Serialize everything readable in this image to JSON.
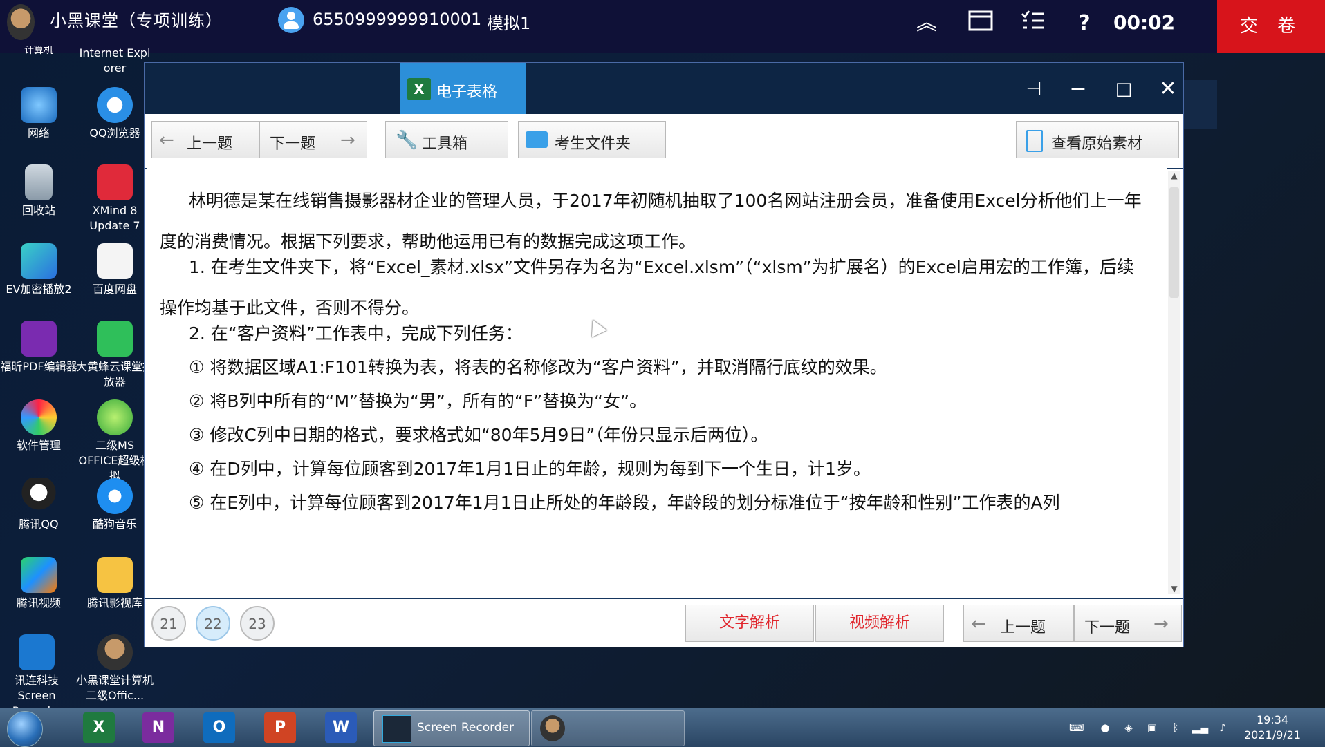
{
  "topbar": {
    "title": "小黑课堂（专项训练）",
    "user_id": "6550999999910001",
    "mode": "模拟1",
    "timer": "00:02",
    "submit_label": "交 卷"
  },
  "desktop": {
    "partial_labels": [
      "计算机",
      "Internet Expl orer"
    ],
    "icons": [
      {
        "label": "网络"
      },
      {
        "label": "QQ浏览器"
      },
      {
        "label": "回收站"
      },
      {
        "label": "XMind 8 Update 7"
      },
      {
        "label": "EV加密播放2"
      },
      {
        "label": "百度网盘"
      },
      {
        "label": "福昕PDF编辑器"
      },
      {
        "label": "大黄蜂云课堂播放器"
      },
      {
        "label": "软件管理"
      },
      {
        "label": "二级MS OFFICE超级模拟"
      },
      {
        "label": "腾讯QQ"
      },
      {
        "label": "酷狗音乐"
      },
      {
        "label": "腾讯视频"
      },
      {
        "label": "腾讯影视库"
      },
      {
        "label": "讯连科技 Screen Record..."
      },
      {
        "label": "小黑课堂计算机二级Offic..."
      }
    ]
  },
  "window": {
    "tab_label": "电子表格",
    "tab_badge": "X",
    "toolbar": {
      "prev": "上一题",
      "next": "下一题",
      "toolbox": "工具箱",
      "folder": "考生文件夹",
      "view_original": "查看原始素材"
    },
    "paragraphs": [
      "林明德是某在线销售摄影器材企业的管理人员，于2017年初随机抽取了100名网站注册会员，准备使用Excel分析他们上一年度的消费情况。根据下列要求，帮助他运用已有的数据完成这项工作。",
      "1. 在考生文件夹下，将“Excel_素材.xlsx”文件另存为名为“Excel.xlsm”（“xlsm”为扩展名）的Excel启用宏的工作簿，后续操作均基于此文件，否则不得分。",
      "2. 在“客户资料”工作表中，完成下列任务：",
      "① 将数据区域A1:F101转换为表，将表的名称修改为“客户资料”，并取消隔行底纹的效果。",
      "② 将B列中所有的“M”替换为“男”，所有的“F”替换为“女”。",
      "③ 修改C列中日期的格式，要求格式如“80年5月9日”（年份只显示后两位）。",
      "④ 在D列中，计算每位顾客到2017年1月1日止的年龄，规则为每到下一个生日，计1岁。",
      "⑤ 在E列中，计算每位顾客到2017年1月1日止所处的年龄段，年龄段的划分标准位于“按年龄和性别”工作表的A列"
    ],
    "bottom": {
      "questions": [
        "21",
        "22",
        "23"
      ],
      "active_question": "22",
      "text_analysis": "文字解析",
      "video_analysis": "视频解析",
      "prev": "上一题",
      "next": "下一题"
    }
  },
  "taskbar": {
    "active_app": "Screen Recorder",
    "time": "19:34",
    "date": "2021/9/21"
  }
}
